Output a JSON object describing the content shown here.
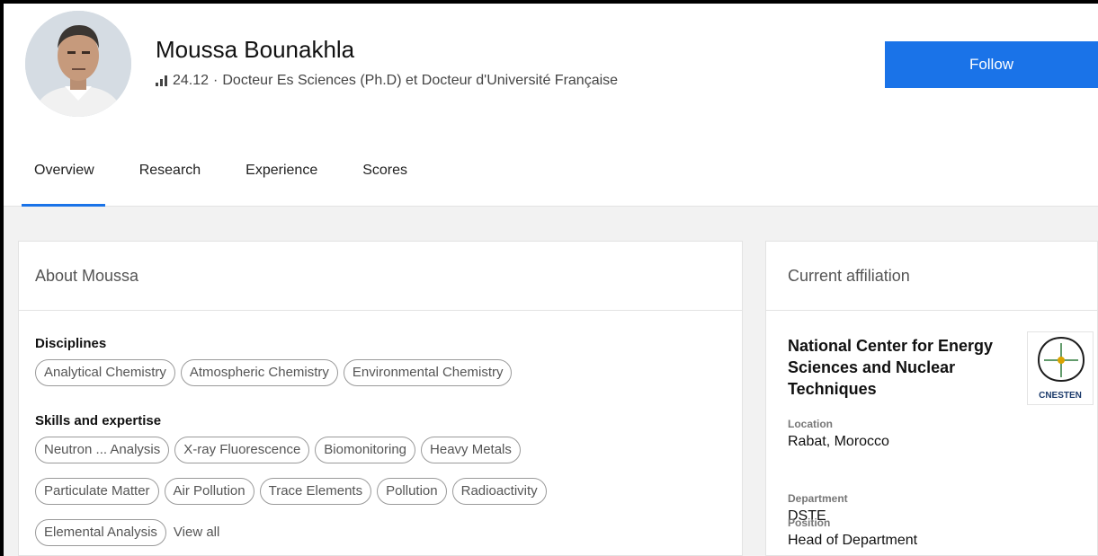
{
  "profile": {
    "name": "Moussa Bounakhla",
    "score": "24.12",
    "separator": "·",
    "headline": "Docteur Es Sciences (Ph.D) et Docteur d'Université Française",
    "follow_label": "Follow"
  },
  "tabs": [
    {
      "label": "Overview",
      "active": true
    },
    {
      "label": "Research",
      "active": false
    },
    {
      "label": "Experience",
      "active": false
    },
    {
      "label": "Scores",
      "active": false
    }
  ],
  "about": {
    "title": "About Moussa",
    "disciplines_label": "Disciplines",
    "disciplines": [
      "Analytical Chemistry",
      "Atmospheric Chemistry",
      "Environmental Chemistry"
    ],
    "skills_label": "Skills and expertise",
    "skills": [
      "Neutron ... Analysis",
      "X-ray Fluorescence",
      "Biomonitoring",
      "Heavy Metals",
      "Particulate Matter",
      "Air Pollution",
      "Trace Elements",
      "Pollution",
      "Radioactivity",
      "Elemental Analysis"
    ],
    "view_all_label": "View all"
  },
  "affiliation": {
    "title": "Current affiliation",
    "institution": "National Center for Energy Sciences and Nuclear Techniques",
    "logo_text": "CNESTEN",
    "location_label": "Location",
    "location": "Rabat, Morocco",
    "department_label": "Department",
    "department": "DSTE",
    "position_label": "Position",
    "position": "Head of Department"
  },
  "colors": {
    "accent": "#1a73e8",
    "page_background": "#f2f2f2"
  },
  "icons": {
    "score": "bar-chart-icon",
    "avatar": "profile-photo"
  }
}
